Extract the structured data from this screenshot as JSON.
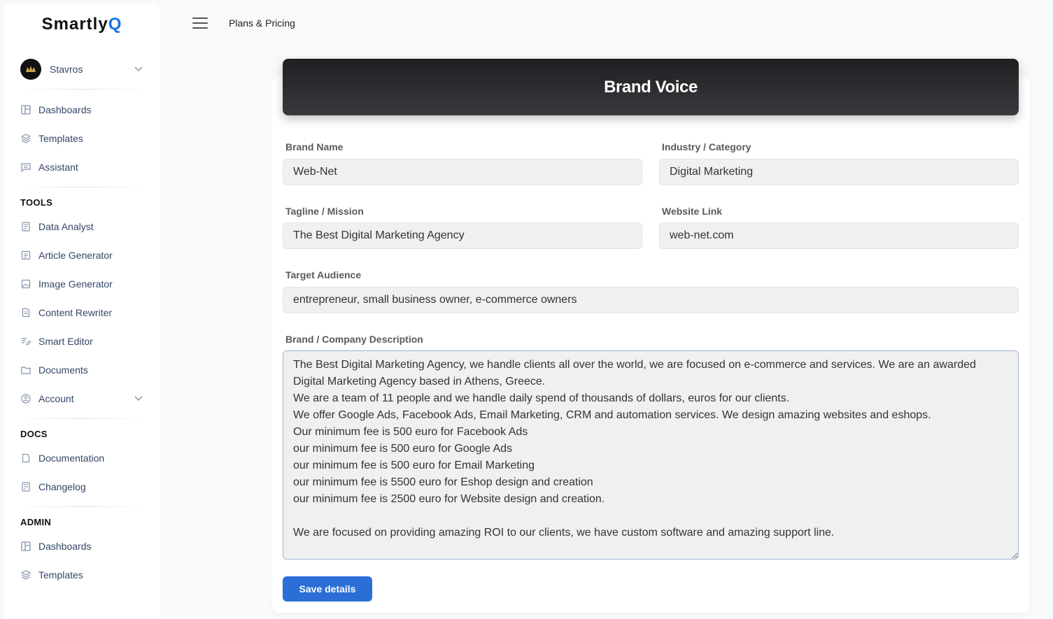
{
  "sidebar": {
    "logo_main": "Smartly",
    "logo_accent": "Q",
    "user": {
      "name": "Stavros",
      "avatar_icon": "brand-crest-icon"
    },
    "main_items": [
      {
        "label": "Dashboards",
        "icon": "dashboard-icon"
      },
      {
        "label": "Templates",
        "icon": "layers-icon"
      },
      {
        "label": "Assistant",
        "icon": "chat-icon"
      }
    ],
    "tools_title": "TOOLS",
    "tools_items": [
      {
        "label": "Data Analyst",
        "icon": "report-icon"
      },
      {
        "label": "Article Generator",
        "icon": "article-icon"
      },
      {
        "label": "Image Generator",
        "icon": "image-icon"
      },
      {
        "label": "Content Rewriter",
        "icon": "document-icon"
      },
      {
        "label": "Smart Editor",
        "icon": "edit-icon"
      },
      {
        "label": "Documents",
        "icon": "folder-icon"
      },
      {
        "label": "Account",
        "icon": "user-circle-icon"
      }
    ],
    "docs_title": "DOCS",
    "docs_items": [
      {
        "label": "Documentation",
        "icon": "file-icon"
      },
      {
        "label": "Changelog",
        "icon": "changelog-icon"
      }
    ],
    "admin_title": "ADMIN",
    "admin_items": [
      {
        "label": "Dashboards",
        "icon": "dashboard-icon"
      },
      {
        "label": "Templates",
        "icon": "layers-icon"
      }
    ]
  },
  "topbar": {
    "breadcrumb": "Plans & Pricing"
  },
  "form": {
    "title": "Brand Voice",
    "brand_name_label": "Brand Name",
    "brand_name_value": "Web-Net",
    "industry_label": "Industry / Category",
    "industry_value": "Digital Marketing",
    "tagline_label": "Tagline / Mission",
    "tagline_value": "The Best Digital Marketing Agency",
    "website_label": "Website Link",
    "website_value": "web-net.com",
    "audience_label": "Target Audience",
    "audience_value": "entrepreneur, small business owner, e-commerce owners",
    "description_label": "Brand / Company Description",
    "description_value": "The Best Digital Marketing Agency, we handle clients all over the world, we are focused on e-commerce and services. We are an awarded Digital Marketing Agency based in Athens, Greece.\nWe are a team of 11 people and we handle daily spend of thousands of dollars, euros for our clients.\nWe offer Google Ads, Facebook Ads, Email Marketing, CRM and automation services. We design amazing websites and eshops.\nOur minimum fee is 500 euro for Facebook Ads\nour minimum fee is 500 euro for Google Ads\nour minimum fee is 500 euro for Email Marketing\nour minimum fee is 5500 euro for Eshop design and creation\nour minimum fee is 2500 euro for Website design and creation.\n\nWe are focused on providing amazing ROI to our clients, we have custom software and amazing support line.",
    "save_label": "Save details"
  },
  "colors": {
    "accent": "#2b6fd6",
    "header_dark": "#2a2a2d",
    "logo_accent": "#1a73e8"
  }
}
